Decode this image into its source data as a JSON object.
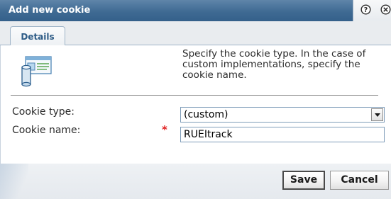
{
  "dialog": {
    "title": "Add new cookie",
    "help_icon": "help-icon",
    "close_icon": "close-icon"
  },
  "tabs": [
    {
      "label": "Details"
    }
  ],
  "icon": "cookie-icon",
  "description": "Specify the cookie type. In the case of custom implementations, specify the cookie name.",
  "form": {
    "cookie_type": {
      "label": "Cookie type:",
      "value": "(custom)"
    },
    "cookie_name": {
      "label": "Cookie name:",
      "required_marker": "*",
      "value": "RUEItrack"
    }
  },
  "buttons": {
    "save_label": "Save",
    "cancel_label": "Cancel"
  },
  "colors": {
    "title_bar": "#3f6a93",
    "tab_text": "#2d5b86",
    "required": "#e02020"
  }
}
